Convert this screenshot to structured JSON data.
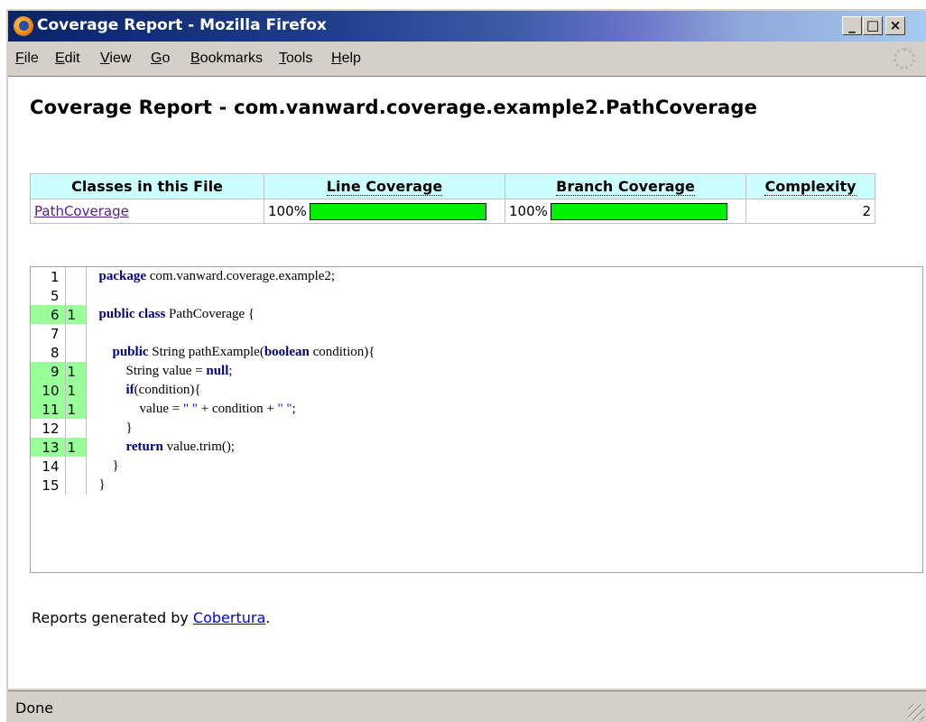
{
  "window": {
    "title": "Coverage Report - Mozilla Firefox",
    "controls": {
      "minimize": "_",
      "maximize": "□",
      "close": "×"
    }
  },
  "menubar": {
    "items": [
      {
        "label": "File",
        "accel": "F"
      },
      {
        "label": "Edit",
        "accel": "E"
      },
      {
        "label": "View",
        "accel": "V"
      },
      {
        "label": "Go",
        "accel": "G"
      },
      {
        "label": "Bookmarks",
        "accel": "B"
      },
      {
        "label": "Tools",
        "accel": "T"
      },
      {
        "label": "Help",
        "accel": "H"
      }
    ]
  },
  "page": {
    "heading": "Coverage Report - com.vanward.coverage.example2.PathCoverage",
    "summary_table": {
      "headers": [
        "Classes in this File",
        "Line Coverage",
        "Branch Coverage",
        "Complexity"
      ],
      "rows": [
        {
          "class_name": "PathCoverage",
          "line_coverage": "100%",
          "line_coverage_fraction": 1.0,
          "branch_coverage": "100%",
          "branch_coverage_fraction": 1.0,
          "complexity": "2"
        }
      ]
    },
    "source_lines": [
      {
        "num": "1",
        "hits": "",
        "code": "package com.vanward.coverage.example2;"
      },
      {
        "num": "5",
        "hits": "",
        "code": ""
      },
      {
        "num": "6",
        "hits": "1",
        "code": "public class PathCoverage {"
      },
      {
        "num": "7",
        "hits": "",
        "code": ""
      },
      {
        "num": "8",
        "hits": "",
        "code": "    public String pathExample(boolean condition){"
      },
      {
        "num": "9",
        "hits": "1",
        "code": "        String value = null;"
      },
      {
        "num": "10",
        "hits": "1",
        "code": "        if(condition){"
      },
      {
        "num": "11",
        "hits": "1",
        "code": "            value = \" \" + condition + \" \";"
      },
      {
        "num": "12",
        "hits": "",
        "code": "        }"
      },
      {
        "num": "13",
        "hits": "1",
        "code": "        return value.trim();"
      },
      {
        "num": "14",
        "hits": "",
        "code": "    }"
      },
      {
        "num": "15",
        "hits": "",
        "code": "}"
      }
    ],
    "footer": {
      "prefix": "Reports generated by ",
      "link": "Cobertura",
      "suffix": "."
    }
  },
  "status": {
    "text": "Done"
  },
  "colors": {
    "header_bg": "#ccffff",
    "coverage_bar": "#00ee00",
    "hit_line_bg": "#99ff99",
    "keyword": "#000080"
  }
}
